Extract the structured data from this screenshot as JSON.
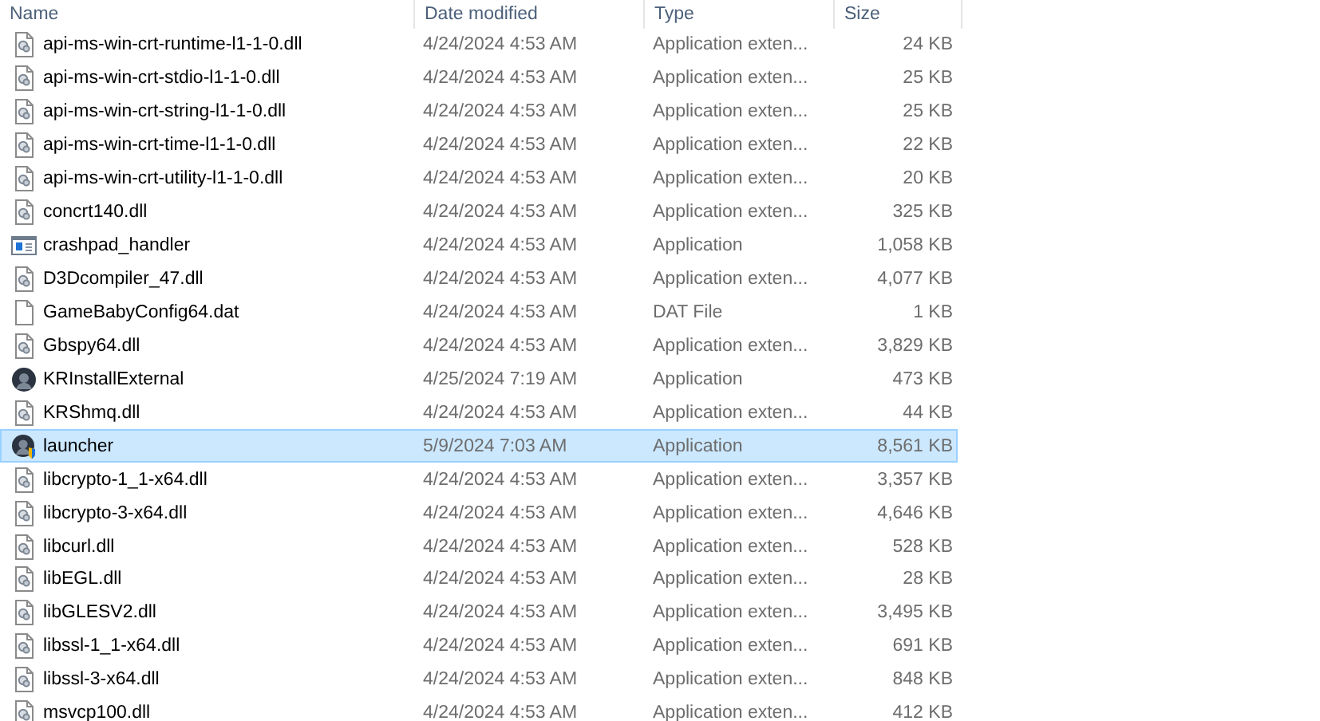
{
  "columns": [
    "Name",
    "Date modified",
    "Type",
    "Size"
  ],
  "rows": [
    {
      "kind": "dll",
      "name": "api-ms-win-crt-runtime-l1-1-0.dll",
      "date": "4/24/2024 4:53 AM",
      "type": "Application exten...",
      "size": "24 KB",
      "selected": false
    },
    {
      "kind": "dll",
      "name": "api-ms-win-crt-stdio-l1-1-0.dll",
      "date": "4/24/2024 4:53 AM",
      "type": "Application exten...",
      "size": "25 KB",
      "selected": false
    },
    {
      "kind": "dll",
      "name": "api-ms-win-crt-string-l1-1-0.dll",
      "date": "4/24/2024 4:53 AM",
      "type": "Application exten...",
      "size": "25 KB",
      "selected": false
    },
    {
      "kind": "dll",
      "name": "api-ms-win-crt-time-l1-1-0.dll",
      "date": "4/24/2024 4:53 AM",
      "type": "Application exten...",
      "size": "22 KB",
      "selected": false
    },
    {
      "kind": "dll",
      "name": "api-ms-win-crt-utility-l1-1-0.dll",
      "date": "4/24/2024 4:53 AM",
      "type": "Application exten...",
      "size": "20 KB",
      "selected": false
    },
    {
      "kind": "dll",
      "name": "concrt140.dll",
      "date": "4/24/2024 4:53 AM",
      "type": "Application exten...",
      "size": "325 KB",
      "selected": false
    },
    {
      "kind": "exe",
      "name": "crashpad_handler",
      "date": "4/24/2024 4:53 AM",
      "type": "Application",
      "size": "1,058 KB",
      "selected": false
    },
    {
      "kind": "dll",
      "name": "D3Dcompiler_47.dll",
      "date": "4/24/2024 4:53 AM",
      "type": "Application exten...",
      "size": "4,077 KB",
      "selected": false
    },
    {
      "kind": "file",
      "name": "GameBabyConfig64.dat",
      "date": "4/24/2024 4:53 AM",
      "type": "DAT File",
      "size": "1 KB",
      "selected": false
    },
    {
      "kind": "dll",
      "name": "Gbspy64.dll",
      "date": "4/24/2024 4:53 AM",
      "type": "Application exten...",
      "size": "3,829 KB",
      "selected": false
    },
    {
      "kind": "app",
      "name": "KRInstallExternal",
      "date": "4/25/2024 7:19 AM",
      "type": "Application",
      "size": "473 KB",
      "selected": false
    },
    {
      "kind": "dll",
      "name": "KRShmq.dll",
      "date": "4/24/2024 4:53 AM",
      "type": "Application exten...",
      "size": "44 KB",
      "selected": false
    },
    {
      "kind": "admin",
      "name": "launcher",
      "date": "5/9/2024 7:03 AM",
      "type": "Application",
      "size": "8,561 KB",
      "selected": true
    },
    {
      "kind": "dll",
      "name": "libcrypto-1_1-x64.dll",
      "date": "4/24/2024 4:53 AM",
      "type": "Application exten...",
      "size": "3,357 KB",
      "selected": false
    },
    {
      "kind": "dll",
      "name": "libcrypto-3-x64.dll",
      "date": "4/24/2024 4:53 AM",
      "type": "Application exten...",
      "size": "4,646 KB",
      "selected": false
    },
    {
      "kind": "dll",
      "name": "libcurl.dll",
      "date": "4/24/2024 4:53 AM",
      "type": "Application exten...",
      "size": "528 KB",
      "selected": false
    },
    {
      "kind": "dll",
      "name": "libEGL.dll",
      "date": "4/24/2024 4:53 AM",
      "type": "Application exten...",
      "size": "28 KB",
      "selected": false
    },
    {
      "kind": "dll",
      "name": "libGLESV2.dll",
      "date": "4/24/2024 4:53 AM",
      "type": "Application exten...",
      "size": "3,495 KB",
      "selected": false
    },
    {
      "kind": "dll",
      "name": "libssl-1_1-x64.dll",
      "date": "4/24/2024 4:53 AM",
      "type": "Application exten...",
      "size": "691 KB",
      "selected": false
    },
    {
      "kind": "dll",
      "name": "libssl-3-x64.dll",
      "date": "4/24/2024 4:53 AM",
      "type": "Application exten...",
      "size": "848 KB",
      "selected": false
    },
    {
      "kind": "dll",
      "name": "msvcp100.dll",
      "date": "4/24/2024 4:53 AM",
      "type": "Application exten...",
      "size": "412 KB",
      "selected": false
    }
  ]
}
